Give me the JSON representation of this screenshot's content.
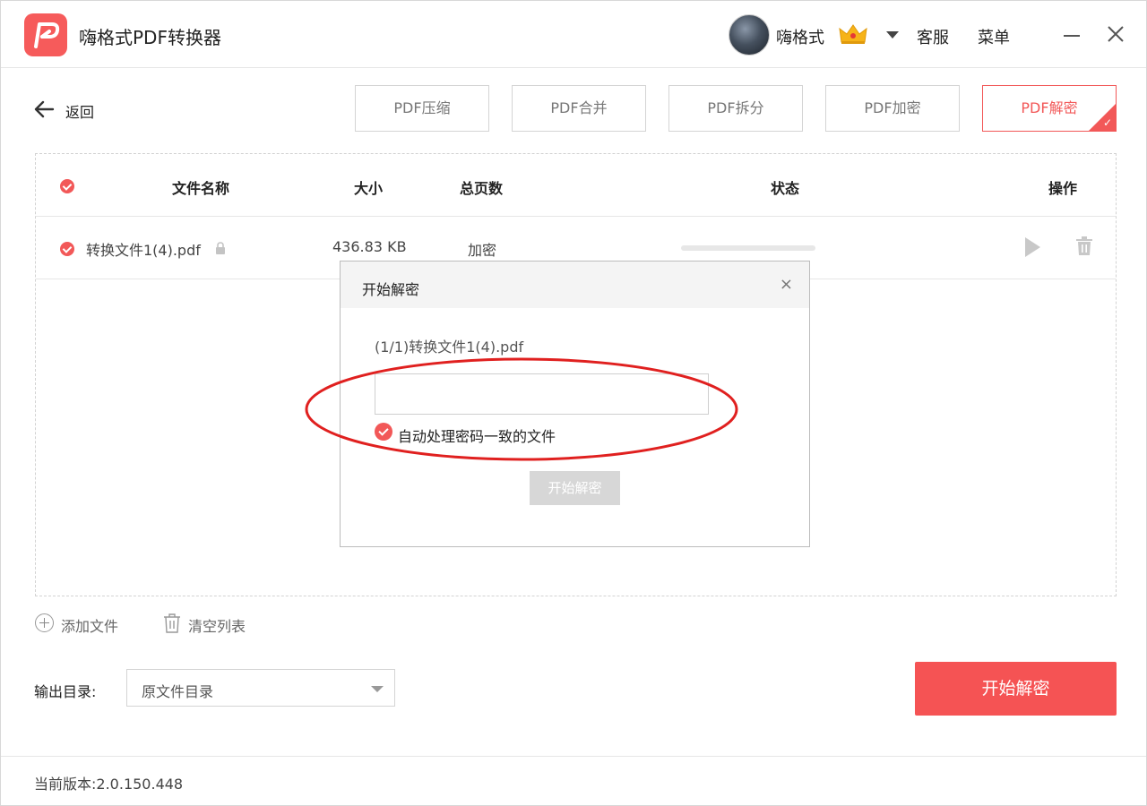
{
  "app": {
    "title": "嗨格式PDF转换器"
  },
  "user": {
    "name": "嗨格式"
  },
  "header": {
    "service_label": "客服",
    "menu_label": "菜单"
  },
  "toolbar": {
    "back_label": "返回",
    "tools": [
      {
        "label": "PDF压缩",
        "active": false
      },
      {
        "label": "PDF合并",
        "active": false
      },
      {
        "label": "PDF拆分",
        "active": false
      },
      {
        "label": "PDF加密",
        "active": false
      },
      {
        "label": "PDF解密",
        "active": true
      }
    ]
  },
  "table": {
    "headers": {
      "name": "文件名称",
      "size": "大小",
      "pages": "总页数",
      "status": "状态",
      "actions": "操作"
    },
    "rows": [
      {
        "name": "转换文件1(4).pdf",
        "size": "436.83 KB",
        "pages": "加密",
        "progress": 0
      }
    ]
  },
  "controls": {
    "add_file": "添加文件",
    "clear_list": "清空列表"
  },
  "output": {
    "label": "输出目录:",
    "value": "原文件目录"
  },
  "start_button": "开始解密",
  "version": {
    "label": "当前版本:",
    "value": "2.0.150.448"
  },
  "modal": {
    "title": "开始解密",
    "close": "×",
    "file_label": "(1/1)转换文件1(4).pdf",
    "password_value": "",
    "auto_label": "自动处理密码一致的文件",
    "auto_checked": true,
    "start_label": "开始解密"
  },
  "colors": {
    "accent": "#f55354",
    "disabled": "#d7d7d7",
    "annotation": "#e0201f"
  }
}
